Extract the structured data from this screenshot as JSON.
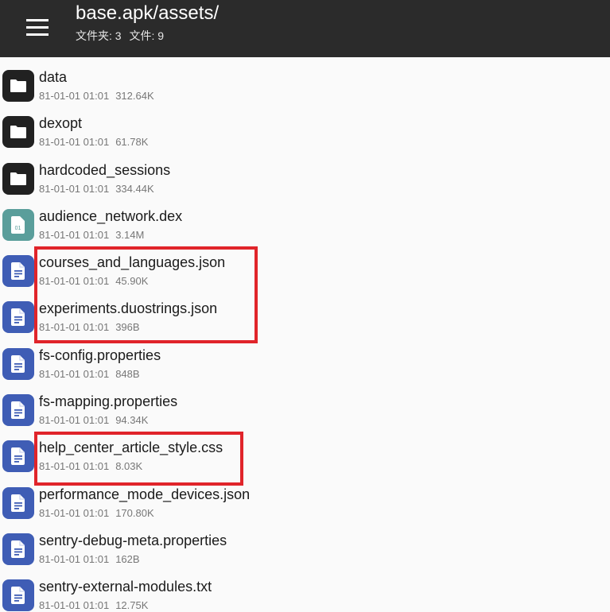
{
  "header": {
    "path": "base.apk/assets/",
    "folders_label": "文件夹: 3",
    "files_label": "文件: 9"
  },
  "files": [
    {
      "name": "data",
      "date": "81-01-01 01:01",
      "size": "312.64K",
      "type": "folder",
      "icon": "folder-icon"
    },
    {
      "name": "dexopt",
      "date": "81-01-01 01:01",
      "size": "61.78K",
      "type": "folder",
      "icon": "folder-icon"
    },
    {
      "name": "hardcoded_sessions",
      "date": "81-01-01 01:01",
      "size": "334.44K",
      "type": "folder",
      "icon": "folder-icon"
    },
    {
      "name": "audience_network.dex",
      "date": "81-01-01 01:01",
      "size": "3.14M",
      "type": "binary",
      "icon": "binary-file-icon",
      "icon_text": "01"
    },
    {
      "name": "courses_and_languages.json",
      "date": "81-01-01 01:01",
      "size": "45.90K",
      "type": "doc",
      "icon": "document-icon"
    },
    {
      "name": "experiments.duostrings.json",
      "date": "81-01-01 01:01",
      "size": "396B",
      "type": "doc",
      "icon": "document-icon"
    },
    {
      "name": "fs-config.properties",
      "date": "81-01-01 01:01",
      "size": "848B",
      "type": "doc",
      "icon": "document-icon"
    },
    {
      "name": "fs-mapping.properties",
      "date": "81-01-01 01:01",
      "size": "94.34K",
      "type": "doc",
      "icon": "document-icon"
    },
    {
      "name": "help_center_article_style.css",
      "date": "81-01-01 01:01",
      "size": "8.03K",
      "type": "doc",
      "icon": "document-icon"
    },
    {
      "name": "performance_mode_devices.json",
      "date": "81-01-01 01:01",
      "size": "170.80K",
      "type": "doc",
      "icon": "document-icon"
    },
    {
      "name": "sentry-debug-meta.properties",
      "date": "81-01-01 01:01",
      "size": "162B",
      "type": "doc",
      "icon": "document-icon"
    },
    {
      "name": "sentry-external-modules.txt",
      "date": "81-01-01 01:01",
      "size": "12.75K",
      "type": "doc",
      "icon": "document-icon"
    }
  ],
  "colors": {
    "toolbar": "#2b2b2b",
    "folder_tile": "#212121",
    "binary_tile": "#5a9e9b",
    "doc_tile": "#3f5db5",
    "highlight_border": "#e0242a"
  }
}
